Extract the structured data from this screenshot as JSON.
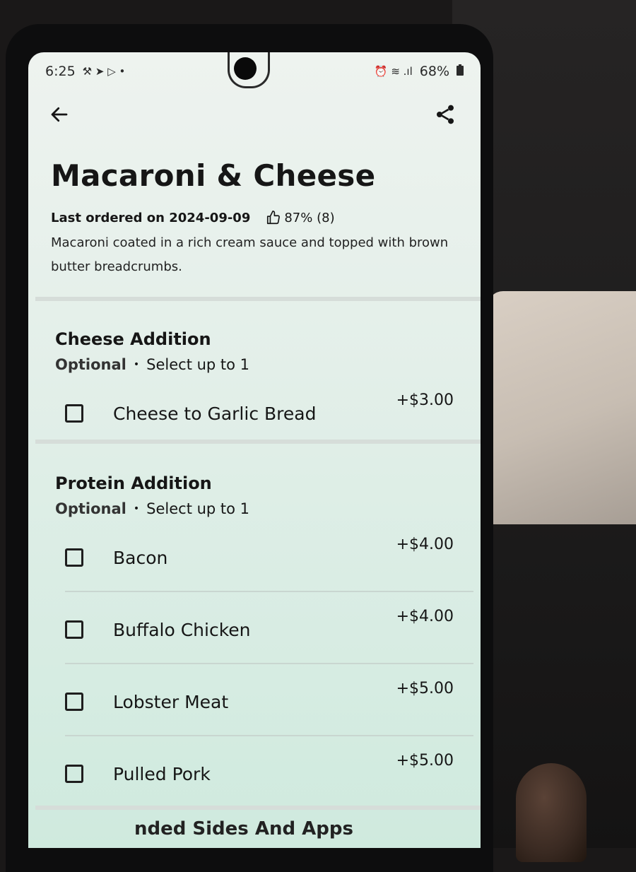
{
  "status_bar": {
    "time": "6:25",
    "left_glyphs": "⚒ ➤ ▷ •",
    "right_glyphs": "⏰ ≋ .ıl",
    "battery": "68%"
  },
  "dish": {
    "name": "Macaroni & Cheese",
    "last_ordered": "Last ordered on 2024-09-09",
    "rating": "87% (8)",
    "description": "Macaroni coated in a rich cream sauce and topped with brown butter breadcrumbs."
  },
  "sections": [
    {
      "title": "Cheese Addition",
      "optional_label": "Optional",
      "select_label": "Select up to 1",
      "options": [
        {
          "name": "Cheese to Garlic Bread",
          "price": "+$3.00"
        }
      ]
    },
    {
      "title": "Protein Addition",
      "optional_label": "Optional",
      "select_label": "Select up to 1",
      "options": [
        {
          "name": "Bacon",
          "price": "+$4.00"
        },
        {
          "name": "Buffalo Chicken",
          "price": "+$4.00"
        },
        {
          "name": "Lobster Meat",
          "price": "+$5.00"
        },
        {
          "name": "Pulled Pork",
          "price": "+$5.00"
        }
      ]
    }
  ],
  "next_section_partial": "nded Sides And Apps",
  "icons": {
    "back": "back-arrow-icon",
    "share": "share-icon",
    "thumbs_up": "thumbs-up-icon",
    "battery": "battery-icon"
  }
}
